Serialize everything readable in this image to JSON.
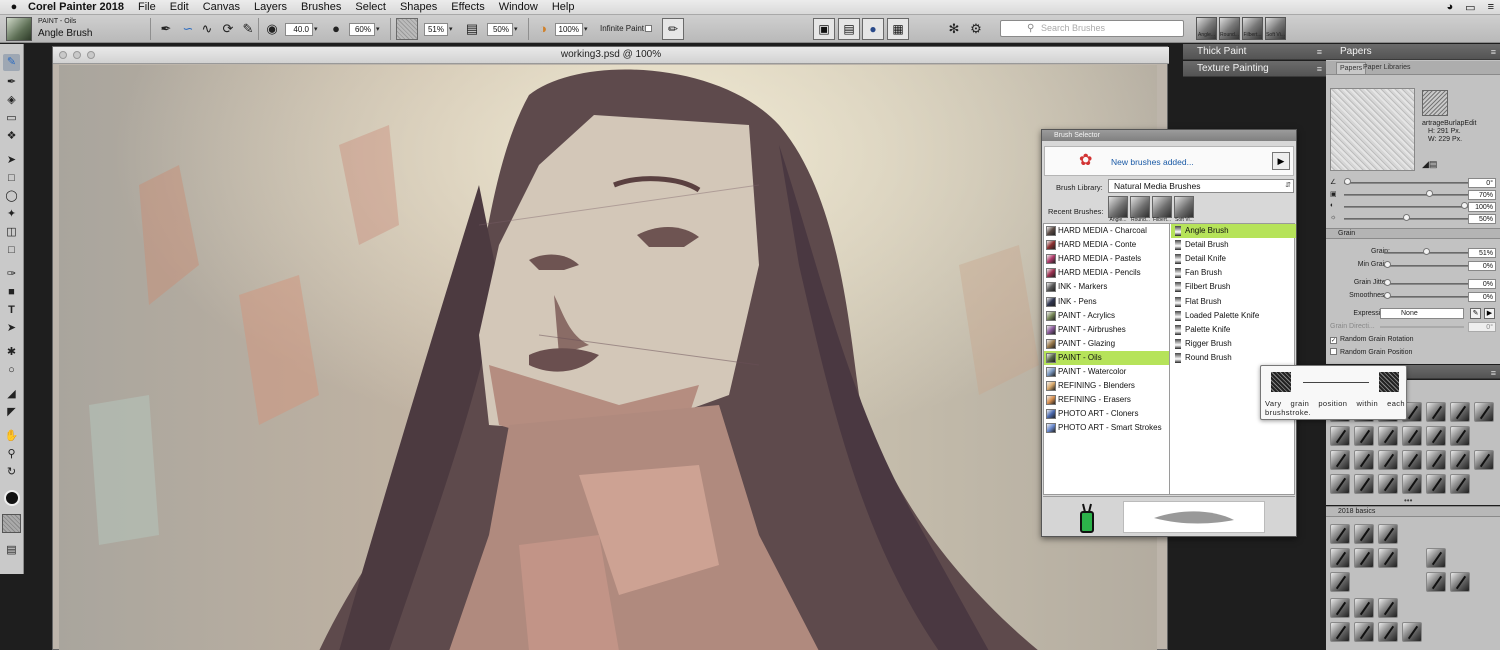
{
  "menubar": {
    "apple": "",
    "app_name": "Corel Painter 2018",
    "items": [
      "File",
      "Edit",
      "Canvas",
      "Layers",
      "Brushes",
      "Select",
      "Shapes",
      "Effects",
      "Window",
      "Help"
    ]
  },
  "propbar": {
    "brush_category": "PAINT - Oils",
    "brush_variant": "Angle Brush",
    "size": "40.0",
    "opacity": "60%",
    "grain": "51%",
    "blend": "50%",
    "resat": "100%",
    "infinite_paint_label": "Infinite Paint",
    "search_placeholder": "Search Brushes",
    "recent": [
      "Angle...",
      "Round...",
      "Filbert...",
      "Soft Vi..."
    ]
  },
  "canvas": {
    "title": "working3.psd @ 100%"
  },
  "panels": {
    "thick_paint": "Thick Paint",
    "texture_painting": "Texture Painting",
    "papers": {
      "title": "Papers",
      "tabs": [
        "Papers",
        "Paper Libraries"
      ],
      "paper_name": "artrageBurlapEdit",
      "height": "H: 291 Px.",
      "width": "W: 229 Px.",
      "sliders": [
        {
          "value_text": "0°",
          "level": 0.0
        },
        {
          "value_text": "70%",
          "level": 0.7
        },
        {
          "value_text": "100%",
          "level": 1.0
        },
        {
          "value_text": "50%",
          "level": 0.5
        }
      ]
    },
    "grain": {
      "title": "Grain",
      "rows": [
        {
          "label": "Grain:",
          "value": "51%",
          "level": 0.51
        },
        {
          "label": "Min Grain:",
          "value": "0%",
          "level": 0.0
        },
        {
          "label": "Grain Jitter:",
          "value": "0%",
          "level": 0.0
        },
        {
          "label": "Smoothness:",
          "value": "0%",
          "level": 0.0
        }
      ],
      "expression_label": "Expression:",
      "expression_value": "None",
      "direction_label": "Grain Directi...",
      "direction_value": "0°",
      "random_rotation": "Random Grain Rotation",
      "random_position": "Random Grain Position"
    },
    "basics": "2018 basics"
  },
  "brush_selector": {
    "title": "Brush Selector",
    "new_brushes": "New brushes added...",
    "library_label": "Brush Library:",
    "library_value": "Natural Media Brushes",
    "recent_label": "Recent Brushes:",
    "recent": [
      "Angle...",
      "Round...",
      "Filbert...",
      "Soft Vi..."
    ],
    "categories": [
      {
        "name": "HARD MEDIA - Charcoal",
        "color": "#5b4a44"
      },
      {
        "name": "HARD MEDIA - Conte",
        "color": "#8a2f2f"
      },
      {
        "name": "HARD MEDIA - Pastels",
        "color": "#b03b6b"
      },
      {
        "name": "HARD MEDIA - Pencils",
        "color": "#9c3050"
      },
      {
        "name": "INK - Markers",
        "color": "#5a5a5a"
      },
      {
        "name": "INK - Pens",
        "color": "#2f3550"
      },
      {
        "name": "PAINT - Acrylics",
        "color": "#7a8a5a"
      },
      {
        "name": "PAINT - Airbrushes",
        "color": "#8a5a9a"
      },
      {
        "name": "PAINT - Glazing",
        "color": "#9a7a4a"
      },
      {
        "name": "PAINT - Oils",
        "color": "#5a6a4a"
      },
      {
        "name": "PAINT - Watercolor",
        "color": "#7a98c0"
      },
      {
        "name": "REFINING - Blenders",
        "color": "#d8a86a"
      },
      {
        "name": "REFINING - Erasers",
        "color": "#d89050"
      },
      {
        "name": "PHOTO ART - Cloners",
        "color": "#4a6ab0"
      },
      {
        "name": "PHOTO ART - Smart Strokes",
        "color": "#6a8ad0"
      }
    ],
    "selected_category": "PAINT - Oils",
    "variants": [
      "Angle Brush",
      "Detail Brush",
      "Detail Knife",
      "Fan Brush",
      "Filbert Brush",
      "Flat Brush",
      "Loaded Palette Knife",
      "Palette Knife",
      "Rigger Brush",
      "Round Brush"
    ],
    "selected_variant": "Angle Brush"
  },
  "tooltip": {
    "text": "Vary grain position within each brushstroke."
  },
  "colors": {
    "selection_green": "#b6e35a",
    "link_blue": "#1a5aa6",
    "panel_header": "#5e5e5e"
  }
}
